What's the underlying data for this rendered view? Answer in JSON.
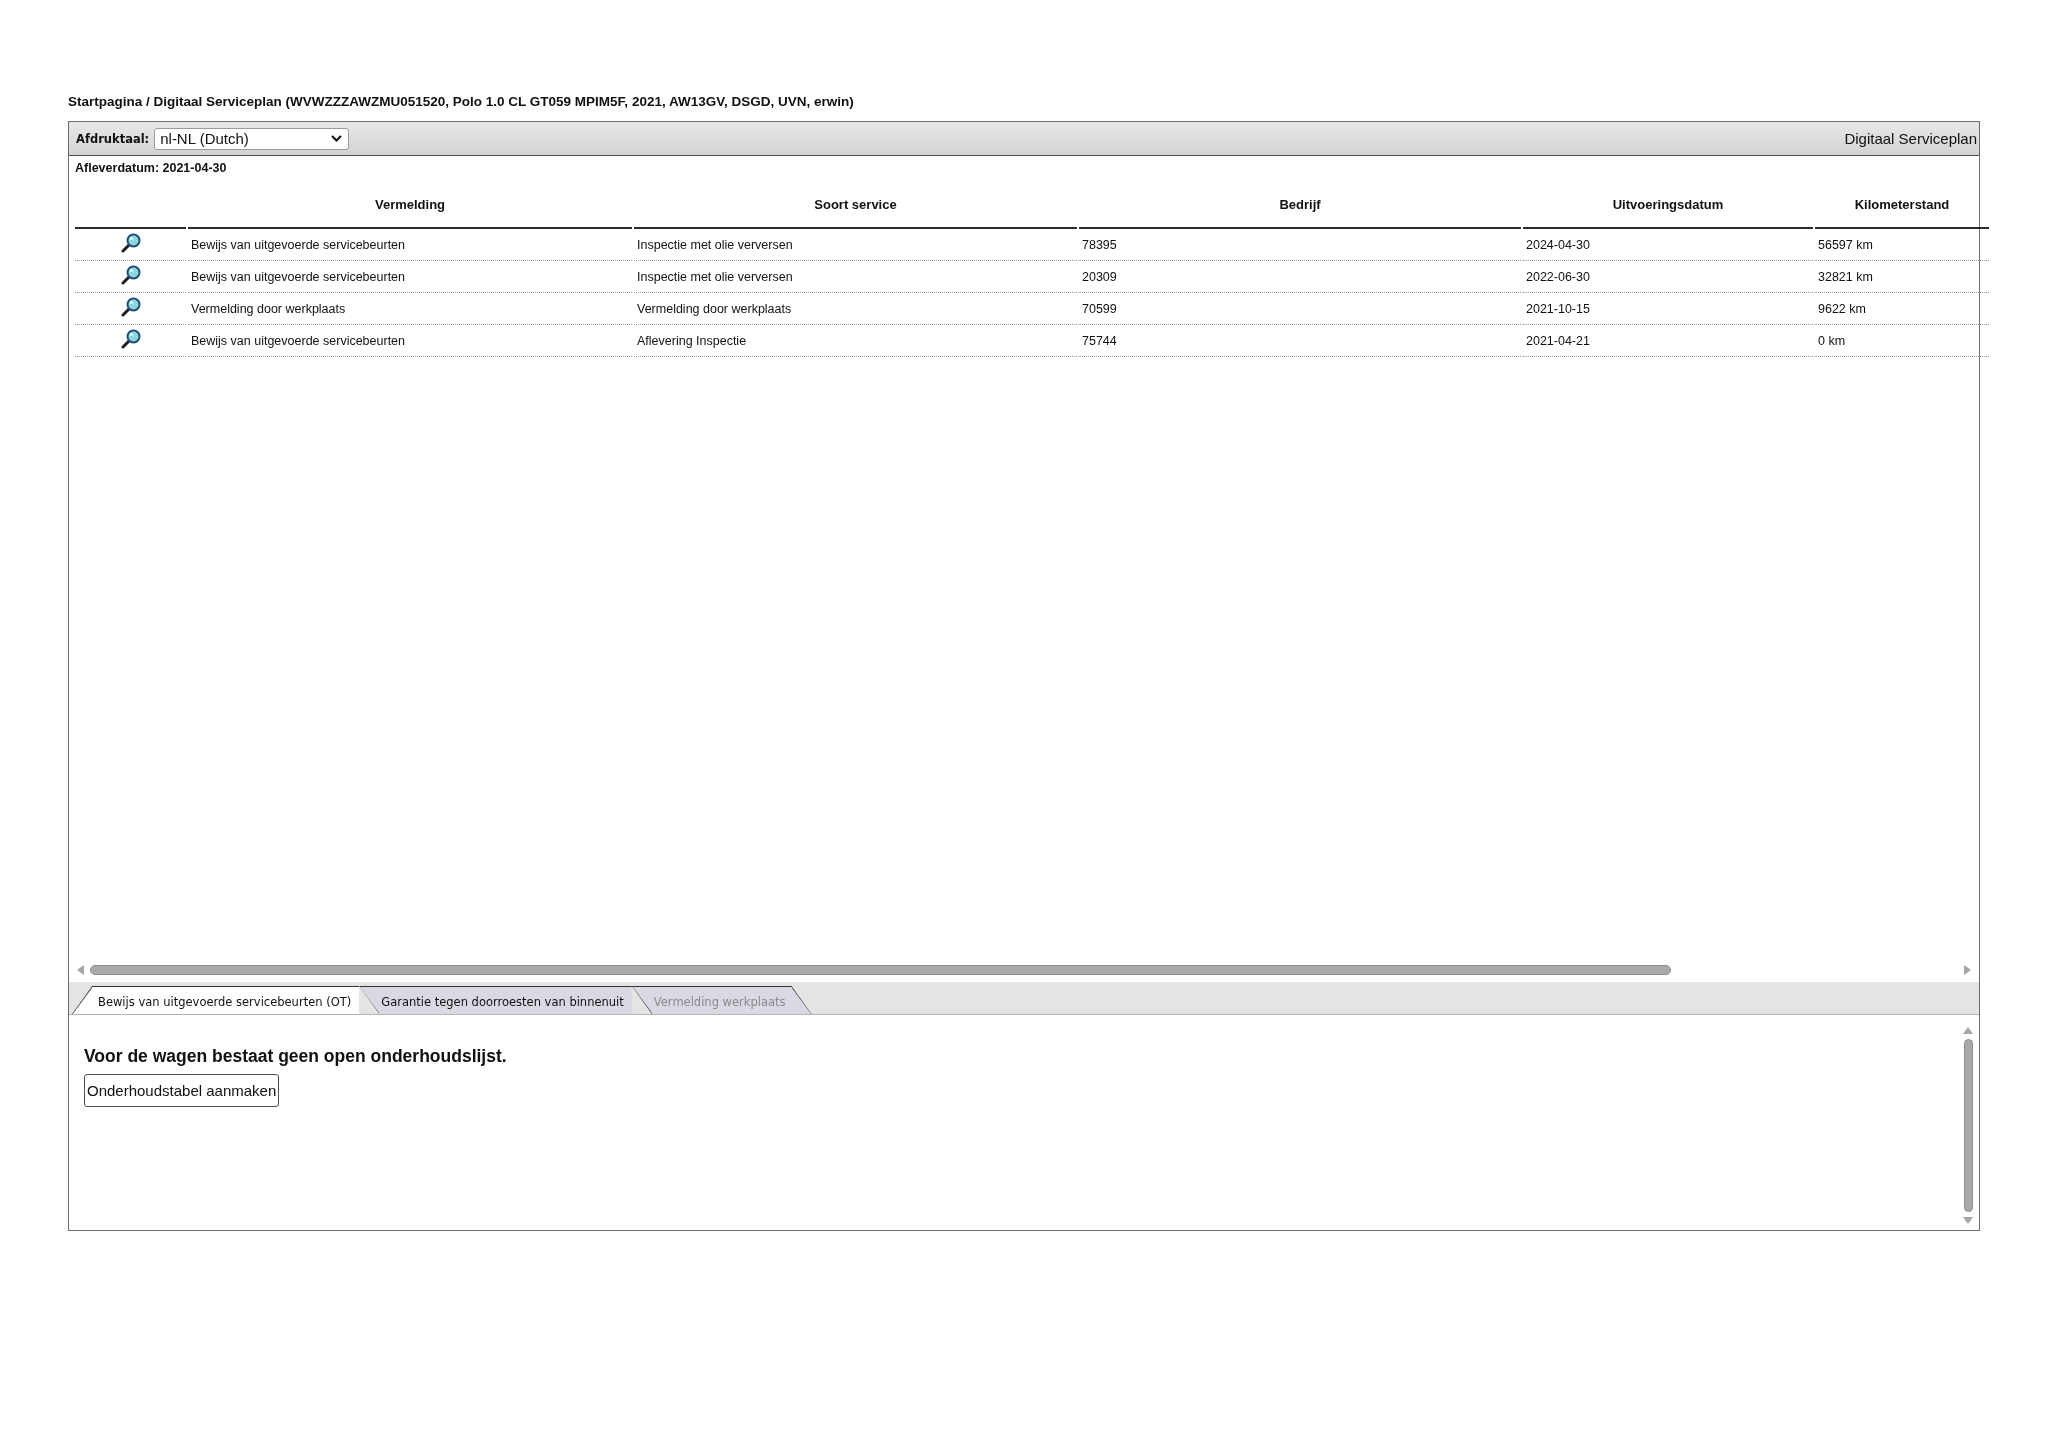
{
  "breadcrumb": "Startpagina / Digitaal Serviceplan (WVWZZZAWZMU051520, Polo 1.0 CL GT059 MPIM5F, 2021, AW13GV, DSGD, UVN, erwin)",
  "header": {
    "language_label": "Afdruktaal:",
    "language_select": {
      "value": "nl-NL (Dutch)"
    },
    "title": "Digitaal Serviceplan"
  },
  "delivery_date": "Afleverdatum: 2021-04-30",
  "table": {
    "columns": [
      "Vermelding",
      "Soort service",
      "Bedrijf",
      "Uitvoeringsdatum",
      "Kilometerstand"
    ],
    "rows": [
      {
        "cells": [
          "Bewijs van uitgevoerde servicebeurten",
          "Inspectie met olie verversen",
          "78395",
          "2024-04-30",
          "56597 km"
        ]
      },
      {
        "cells": [
          "Bewijs van uitgevoerde servicebeurten",
          "Inspectie met olie verversen",
          "20309",
          "2022-06-30",
          "32821 km"
        ]
      },
      {
        "cells": [
          "Vermelding door werkplaats",
          "Vermelding door werkplaats",
          "70599",
          "2021-10-15",
          "9622 km"
        ]
      },
      {
        "cells": [
          "Bewijs van uitgevoerde servicebeurten",
          "Aflevering Inspectie",
          "75744",
          "2021-04-21",
          "0 km"
        ]
      }
    ]
  },
  "tabs": [
    {
      "label": "Bewijs van uitgevoerde servicebeurten (OT)",
      "selected": true,
      "disabled": false
    },
    {
      "label": "Garantie tegen doorroesten van binnenuit",
      "selected": false,
      "disabled": false
    },
    {
      "label": "Vermelding werkplaats",
      "selected": false,
      "disabled": true
    }
  ],
  "tab_panel": {
    "message": "Voor de wagen bestaat geen open onderhoudslijst.",
    "button": "Onderhoudstabel aanmaken"
  }
}
